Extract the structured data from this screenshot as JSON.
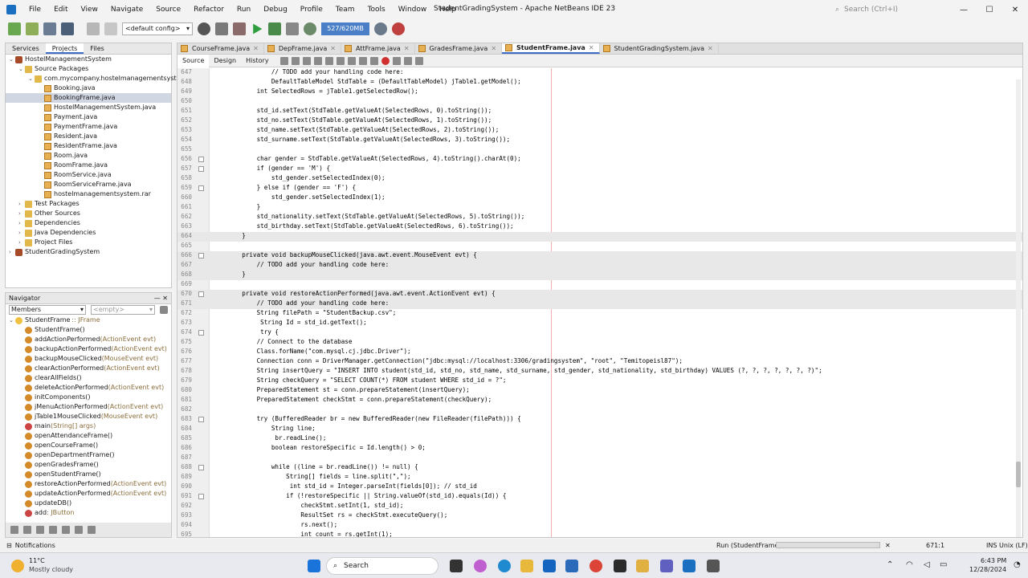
{
  "window": {
    "title": "StudentGradingSystem - Apache NetBeans IDE 23",
    "menu": [
      "File",
      "Edit",
      "View",
      "Navigate",
      "Source",
      "Refactor",
      "Run",
      "Debug",
      "Profile",
      "Team",
      "Tools",
      "Window",
      "Help"
    ],
    "search_placeholder": "Search (Ctrl+I)"
  },
  "toolbar": {
    "config": "<default config>",
    "memory": "527/620MB"
  },
  "project_pane": {
    "tabs": [
      "Services",
      "Projects",
      "Files"
    ],
    "active_tab": "Projects",
    "tree": [
      {
        "label": "HostelManagementSystem",
        "depth": 0,
        "icon": "proj"
      },
      {
        "label": "Source Packages",
        "depth": 1,
        "icon": "folder"
      },
      {
        "label": "com.mycompany.hostelmanagementsystem",
        "depth": 2,
        "icon": "folder"
      },
      {
        "label": "Booking.java",
        "depth": 3,
        "icon": "java"
      },
      {
        "label": "BookingFrame.java",
        "depth": 3,
        "icon": "java",
        "selected": true
      },
      {
        "label": "HostelManagementSystem.java",
        "depth": 3,
        "icon": "java"
      },
      {
        "label": "Payment.java",
        "depth": 3,
        "icon": "java"
      },
      {
        "label": "PaymentFrame.java",
        "depth": 3,
        "icon": "java"
      },
      {
        "label": "Resident.java",
        "depth": 3,
        "icon": "java"
      },
      {
        "label": "ResidentFrame.java",
        "depth": 3,
        "icon": "java"
      },
      {
        "label": "Room.java",
        "depth": 3,
        "icon": "java"
      },
      {
        "label": "RoomFrame.java",
        "depth": 3,
        "icon": "java"
      },
      {
        "label": "RoomService.java",
        "depth": 3,
        "icon": "java"
      },
      {
        "label": "RoomServiceFrame.java",
        "depth": 3,
        "icon": "java"
      },
      {
        "label": "hostelmanagementsystem.rar",
        "depth": 3,
        "icon": "java"
      },
      {
        "label": "Test Packages",
        "depth": 1,
        "icon": "folder"
      },
      {
        "label": "Other Sources",
        "depth": 1,
        "icon": "folder"
      },
      {
        "label": "Dependencies",
        "depth": 1,
        "icon": "folder"
      },
      {
        "label": "Java Dependencies",
        "depth": 1,
        "icon": "folder"
      },
      {
        "label": "Project Files",
        "depth": 1,
        "icon": "folder"
      },
      {
        "label": "StudentGradingSystem",
        "depth": 0,
        "icon": "proj"
      }
    ]
  },
  "navigator": {
    "title": "Navigator",
    "filter": "Members",
    "empty": "<empty>",
    "root": "StudentFrame",
    "root_type": ":: JFrame",
    "members": [
      {
        "name": "StudentFrame()",
        "sig": ""
      },
      {
        "name": "addActionPerformed",
        "sig": "(ActionEvent evt)"
      },
      {
        "name": "backupActionPerformed",
        "sig": "(ActionEvent evt)"
      },
      {
        "name": "backupMouseClicked",
        "sig": "(MouseEvent evt)"
      },
      {
        "name": "clearActionPerformed",
        "sig": "(ActionEvent evt)"
      },
      {
        "name": "clearAllFields()",
        "sig": ""
      },
      {
        "name": "deleteActionPerformed",
        "sig": "(ActionEvent evt)"
      },
      {
        "name": "initComponents()",
        "sig": ""
      },
      {
        "name": "jMenuActionPerformed",
        "sig": "(ActionEvent evt)"
      },
      {
        "name": "jTable1MouseClicked",
        "sig": "(MouseEvent evt)"
      },
      {
        "name": "main",
        "sig": "(String[] args)"
      },
      {
        "name": "openAttendanceFrame()",
        "sig": ""
      },
      {
        "name": "openCourseFrame()",
        "sig": ""
      },
      {
        "name": "openDepartmentFrame()",
        "sig": ""
      },
      {
        "name": "openGradesFrame()",
        "sig": ""
      },
      {
        "name": "openStudentFrame()",
        "sig": ""
      },
      {
        "name": "restoreActionPerformed",
        "sig": "(ActionEvent evt)"
      },
      {
        "name": "updateActionPerformed",
        "sig": "(ActionEvent evt)"
      },
      {
        "name": "updateDB()",
        "sig": ""
      },
      {
        "name": "add",
        "sig": " : JButton"
      }
    ]
  },
  "editor": {
    "tabs": [
      {
        "label": "CourseFrame.java"
      },
      {
        "label": "DepFrame.java"
      },
      {
        "label": "AttFrame.java"
      },
      {
        "label": "GradesFrame.java"
      },
      {
        "label": "StudentFrame.java",
        "active": true
      },
      {
        "label": "StudentGradingSystem.java"
      }
    ],
    "views": [
      "Source",
      "Design",
      "History"
    ],
    "lines": [
      {
        "n": "647",
        "t": "            // TODO add your handling code here:"
      },
      {
        "n": "648",
        "t": "            DefaultTableModel StdTable = (DefaultTableModel) jTable1.getModel();"
      },
      {
        "n": "649",
        "t": "        int SelectedRows = jTable1.getSelectedRow();"
      },
      {
        "n": "650",
        "t": ""
      },
      {
        "n": "651",
        "t": "        std_id.setText(StdTable.getValueAt(SelectedRows, 0).toString());"
      },
      {
        "n": "652",
        "t": "        std_no.setText(StdTable.getValueAt(SelectedRows, 1).toString());"
      },
      {
        "n": "653",
        "t": "        std_name.setText(StdTable.getValueAt(SelectedRows, 2).toString());"
      },
      {
        "n": "654",
        "t": "        std_surname.setText(StdTable.getValueAt(SelectedRows, 3).toString());"
      },
      {
        "n": "655",
        "t": ""
      },
      {
        "n": "656",
        "t": "        char gender = StdTable.getValueAt(SelectedRows, 4).toString().charAt(0);"
      },
      {
        "n": "657",
        "t": "        if (gender == 'M') {"
      },
      {
        "n": "658",
        "t": "            std_gender.setSelectedIndex(0);"
      },
      {
        "n": "659",
        "t": "        } else if (gender == 'F') {"
      },
      {
        "n": "660",
        "t": "            std_gender.setSelectedIndex(1);"
      },
      {
        "n": "661",
        "t": "        }"
      },
      {
        "n": "662",
        "t": "        std_nationality.setText(StdTable.getValueAt(SelectedRows, 5).toString());"
      },
      {
        "n": "663",
        "t": "        std_birthday.setText(StdTable.getValueAt(SelectedRows, 6).toString());"
      },
      {
        "n": "664",
        "t": "    }"
      },
      {
        "n": "665",
        "t": ""
      },
      {
        "n": "666",
        "t": "    private void backupMouseClicked(java.awt.event.MouseEvent evt) {"
      },
      {
        "n": "667",
        "t": "        // TODO add your handling code here:"
      },
      {
        "n": "668",
        "t": "    }"
      },
      {
        "n": "669",
        "t": ""
      },
      {
        "n": "670",
        "t": "    private void restoreActionPerformed(java.awt.event.ActionEvent evt) {"
      },
      {
        "n": "671",
        "t": "        // TODO add your handling code here:"
      },
      {
        "n": "672",
        "t": "        String filePath = \"StudentBackup.csv\";"
      },
      {
        "n": "673",
        "t": "         String Id = std_id.getText();"
      },
      {
        "n": "674",
        "t": "         try {"
      },
      {
        "n": "675",
        "t": "        // Connect to the database"
      },
      {
        "n": "676",
        "t": "        Class.forName(\"com.mysql.cj.jdbc.Driver\");"
      },
      {
        "n": "677",
        "t": "        Connection conn = DriverManager.getConnection(\"jdbc:mysql://localhost:3306/gradingsystem\", \"root\", \"Temitopeisl87\");"
      },
      {
        "n": "678",
        "t": "        String insertQuery = \"INSERT INTO student(std_id, std_no, std_name, std_surname, std_gender, std_nationality, std_birthday) VALUES (?, ?, ?, ?, ?, ?, ?)\";"
      },
      {
        "n": "679",
        "t": "        String checkQuery = \"SELECT COUNT(*) FROM student WHERE std_id = ?\";"
      },
      {
        "n": "680",
        "t": "        PreparedStatement st = conn.prepareStatement(insertQuery);"
      },
      {
        "n": "681",
        "t": "        PreparedStatement checkStmt = conn.prepareStatement(checkQuery);"
      },
      {
        "n": "682",
        "t": ""
      },
      {
        "n": "683",
        "t": "        try (BufferedReader br = new BufferedReader(new FileReader(filePath))) {"
      },
      {
        "n": "684",
        "t": "            String line;"
      },
      {
        "n": "685",
        "t": "             br.readLine();"
      },
      {
        "n": "686",
        "t": "            boolean restoreSpecific = Id.length() > 0;"
      },
      {
        "n": "687",
        "t": ""
      },
      {
        "n": "688",
        "t": "            while ((line = br.readLine()) != null) {"
      },
      {
        "n": "689",
        "t": "                String[] fields = line.split(\",\");"
      },
      {
        "n": "690",
        "t": "                 int std_id = Integer.parseInt(fields[0]); // std_id"
      },
      {
        "n": "691",
        "t": "                if (!restoreSpecific || String.valueOf(std_id).equals(Id)) {"
      },
      {
        "n": "692",
        "t": "                    checkStmt.setInt(1, std_id);"
      },
      {
        "n": "693",
        "t": "                    ResultSet rs = checkStmt.executeQuery();"
      },
      {
        "n": "694",
        "t": "                    rs.next();"
      },
      {
        "n": "695",
        "t": "                    int count = rs.getInt(1);"
      }
    ]
  },
  "statusbar": {
    "notifications": "Notifications",
    "run": "Run (StudentFrame)",
    "position": "671:1",
    "mode": "INS Unix (LF)"
  },
  "taskbar": {
    "weather_temp": "11°C",
    "weather_desc": "Mostly cloudy",
    "search": "Search",
    "time": "6:43 PM",
    "date": "12/28/2024"
  }
}
